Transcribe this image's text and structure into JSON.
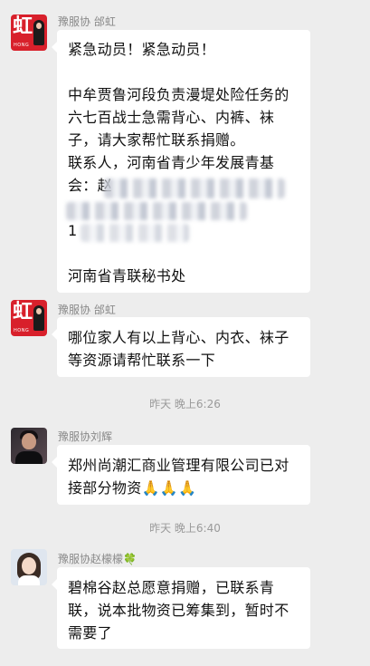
{
  "messages": [
    {
      "sender": "豫服协 邰虹",
      "avatar_glyph": "虹",
      "avatar_sub": "HONG",
      "lines": [
        "紧急动员！紧急动员！",
        "",
        "中牟贾鲁河段负责漫堤处险任务的",
        "六七百战士急需背心、内裤、袜",
        "子，请大家帮忙联系捐赠。",
        "联系人，河南省青少年发展青基",
        "会：赵",
        "",
        "1",
        "",
        "河南省青联秘书处"
      ]
    },
    {
      "sender": "豫服协 邰虹",
      "avatar_glyph": "虹",
      "avatar_sub": "HONG",
      "lines": [
        "哪位家人有以上背心、内衣、袜子",
        "等资源请帮忙联系一下"
      ]
    },
    {
      "sender": "豫服协刘辉",
      "lines": [
        "郑州尚潮汇商业管理有限公司已对",
        "接部分物资🙏🙏🙏"
      ]
    },
    {
      "sender": "豫服协赵檬檬",
      "sender_suffix": "🍀",
      "lines": [
        "碧棉谷赵总愿意捐赠，已联系青",
        "联，说本批物资已筹集到，暂时不",
        "需要了"
      ]
    }
  ],
  "timestamps": [
    "昨天 晚上6:26",
    "昨天 晚上6:40"
  ],
  "colors": {
    "background": "#ededed",
    "bubble": "#ffffff",
    "sender_text": "#8a8a8a",
    "timestamp_text": "#9a9a9a",
    "avatar_red": "#d8202b"
  },
  "icons": [
    "avatar-photo",
    "clover-icon",
    "folded-hands-emoji"
  ]
}
